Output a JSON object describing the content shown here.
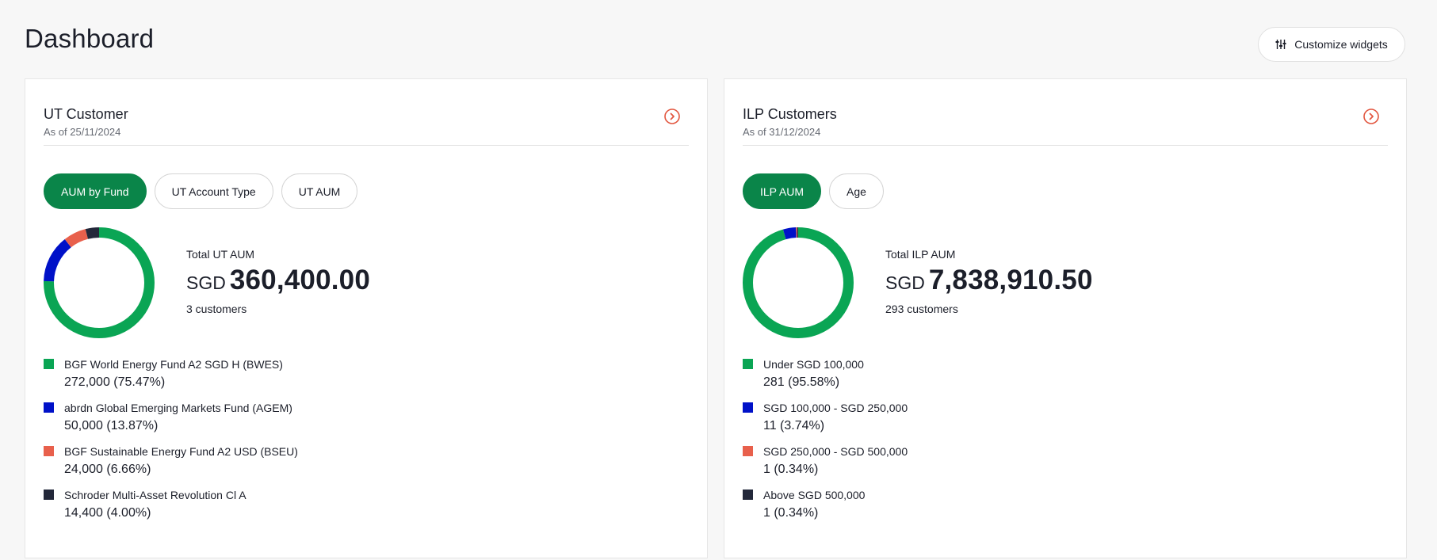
{
  "page": {
    "title": "Dashboard"
  },
  "toolbar": {
    "customize_label": "Customize widgets",
    "customize_icon": "sliders-icon"
  },
  "colors": {
    "green": "#0aa554",
    "blue": "#0011c8",
    "coral": "#e8604c",
    "navy": "#23283a",
    "accent_green": "#0a8549",
    "arrow_red": "#e2563f"
  },
  "ut": {
    "title": "UT Customer",
    "as_of": "As of 25/11/2024",
    "tabs": [
      {
        "label": "AUM by Fund",
        "active": true
      },
      {
        "label": "UT Account Type",
        "active": false
      },
      {
        "label": "UT AUM",
        "active": false
      }
    ],
    "total_label": "Total UT AUM",
    "currency": "SGD",
    "total_value": "360,400.00",
    "customers": "3 customers",
    "legend": [
      {
        "label": "BGF World Energy Fund A2 SGD H (BWES)",
        "value": "272,000 (75.47%)",
        "color": "#0aa554",
        "share": 75.47
      },
      {
        "label": "abrdn Global Emerging Markets Fund (AGEM)",
        "value": "50,000 (13.87%)",
        "color": "#0011c8",
        "share": 13.87
      },
      {
        "label": "BGF Sustainable Energy Fund A2 USD (BSEU)",
        "value": "24,000 (6.66%)",
        "color": "#e8604c",
        "share": 6.66
      },
      {
        "label": "Schroder Multi-Asset Revolution Cl A",
        "value": "14,400 (4.00%)",
        "color": "#23283a",
        "share": 4.0
      }
    ]
  },
  "ilp": {
    "title": "ILP Customers",
    "as_of": "As of 31/12/2024",
    "tabs": [
      {
        "label": "ILP AUM",
        "active": true
      },
      {
        "label": "Age",
        "active": false
      }
    ],
    "total_label": "Total ILP AUM",
    "currency": "SGD",
    "total_value": "7,838,910.50",
    "customers": "293 customers",
    "legend": [
      {
        "label": "Under SGD 100,000",
        "value": "281 (95.58%)",
        "color": "#0aa554",
        "share": 95.58
      },
      {
        "label": "SGD 100,000 - SGD 250,000",
        "value": "11 (3.74%)",
        "color": "#0011c8",
        "share": 3.74
      },
      {
        "label": "SGD 250,000 - SGD 500,000",
        "value": "1 (0.34%)",
        "color": "#e8604c",
        "share": 0.34
      },
      {
        "label": "Above SGD 500,000",
        "value": "1 (0.34%)",
        "color": "#23283a",
        "share": 0.34
      }
    ]
  }
}
